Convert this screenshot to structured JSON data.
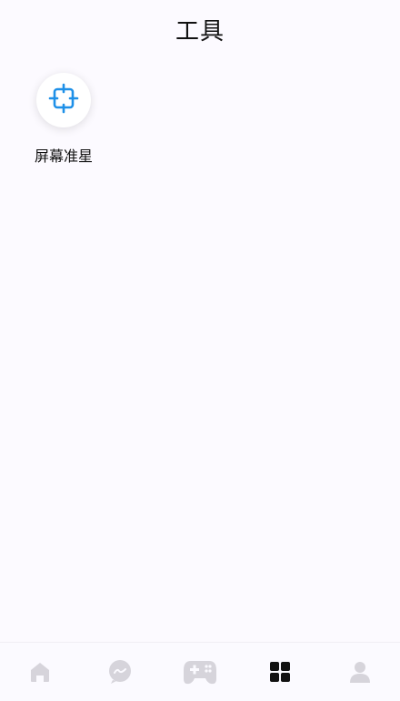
{
  "header": {
    "title": "工具"
  },
  "tools": [
    {
      "label": "屏幕准星",
      "icon": "crosshair-icon",
      "color": "#1e90e8"
    }
  ],
  "bottom_nav": {
    "items": [
      {
        "icon": "home-icon",
        "active": false
      },
      {
        "icon": "chat-bubble-icon",
        "active": false
      },
      {
        "icon": "gamepad-icon",
        "active": false
      },
      {
        "icon": "grid-icon",
        "active": true
      },
      {
        "icon": "profile-icon",
        "active": false
      }
    ],
    "active_color": "#111111",
    "inactive_color": "#d6d4db"
  }
}
